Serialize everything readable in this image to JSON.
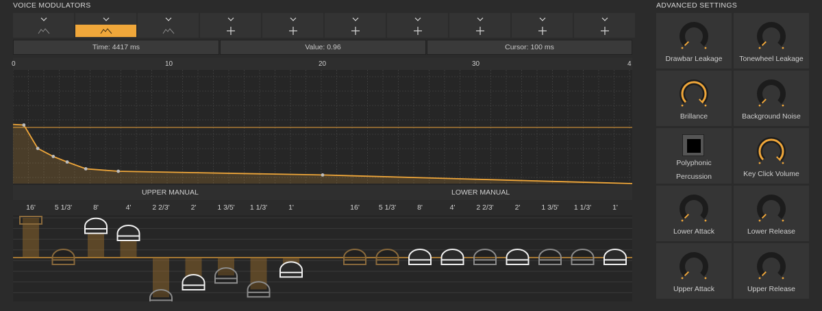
{
  "voice_modulators": {
    "title": "VOICE MODULATORS",
    "slots": [
      {
        "icon": "envelope-wave-icon",
        "active": false
      },
      {
        "icon": "envelope-wave-icon",
        "active": true
      },
      {
        "icon": "envelope-wave-icon",
        "active": false
      },
      {
        "icon": "add-icon",
        "active": false
      },
      {
        "icon": "add-icon",
        "active": false
      },
      {
        "icon": "add-icon",
        "active": false
      },
      {
        "icon": "add-icon",
        "active": false
      },
      {
        "icon": "add-icon",
        "active": false
      },
      {
        "icon": "add-icon",
        "active": false
      },
      {
        "icon": "add-icon",
        "active": false
      }
    ],
    "info": {
      "time": "Time: 4417 ms",
      "value": "Value: 0.96",
      "cursor": "Cursor: 100 ms"
    },
    "ruler": {
      "labels": [
        "0",
        "10",
        "20",
        "30",
        "4"
      ]
    },
    "envelope": {
      "type": "line",
      "x": [
        0,
        0.7,
        1.6,
        2.6,
        3.5,
        4.7,
        6.8,
        20,
        40
      ],
      "y": [
        0.96,
        0.95,
        0.57,
        0.44,
        0.35,
        0.24,
        0.2,
        0.14,
        0.0
      ],
      "reference_level": 0.6,
      "xlim": [
        0,
        40
      ],
      "ylim": [
        0,
        1
      ],
      "grid": true
    }
  },
  "manuals": {
    "upper_label": "UPPER MANUAL",
    "lower_label": "LOWER MANUAL",
    "upper_footages": [
      "16'",
      "5 1/3'",
      "8'",
      "4'",
      "2 2/3'",
      "2'",
      "1 3/5'",
      "1 1/3'",
      "1'"
    ],
    "lower_footages": [
      "16'",
      "5 1/3'",
      "8'",
      "4'",
      "2 2/3'",
      "2'",
      "1 3/5'",
      "1 1/3'",
      "1'"
    ],
    "upper_levels": [
      1.0,
      0.2,
      0.8,
      0.62,
      -1.0,
      -0.62,
      -0.45,
      -0.8,
      -0.3
    ],
    "lower_levels": [
      0.2,
      0.2,
      0.2,
      0.2,
      0.2,
      0.2,
      0.2,
      0.2,
      0.2
    ],
    "upper_states": [
      "orange",
      "orange",
      "white",
      "white",
      "gray",
      "white",
      "gray",
      "gray",
      "white"
    ],
    "lower_states": [
      "orange",
      "orange",
      "white",
      "white",
      "gray",
      "white",
      "gray",
      "gray",
      "white"
    ]
  },
  "advanced_settings": {
    "title": "ADVANCED SETTINGS",
    "drawbar_leakage": {
      "label": "Drawbar Leakage",
      "value": 0.0
    },
    "tonewheel_leakage": {
      "label": "Tonewheel Leakage",
      "value": 0.0
    },
    "brillance": {
      "label": "Brillance",
      "value": 1.0
    },
    "background_noise": {
      "label": "Background Noise",
      "value": 0.0
    },
    "polyphonic_percussion": {
      "label_line1": "Polyphonic",
      "label_line2": "Percussion",
      "checked": true
    },
    "key_click_volume": {
      "label": "Key Click Volume",
      "value": 1.0
    },
    "lower_attack": {
      "label": "Lower Attack",
      "value": 0.0
    },
    "lower_release": {
      "label": "Lower Release",
      "value": 0.0
    },
    "upper_attack": {
      "label": "Upper Attack",
      "value": 0.0
    },
    "upper_release": {
      "label": "Upper Release",
      "value": 0.0
    }
  },
  "colors": {
    "accent": "#f0a73a",
    "panel": "#353535",
    "background": "#2b2b2b"
  }
}
